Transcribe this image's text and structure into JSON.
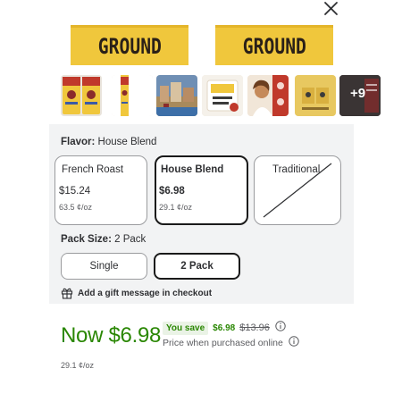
{
  "hero": {
    "bag_text_left": "GROUND",
    "bag_text_right": "GROUND"
  },
  "thumbnails": {
    "items": [
      {
        "name": "product-front-back",
        "bg": "#e9e4dc"
      },
      {
        "name": "product-side",
        "bg": "#f4efe6"
      },
      {
        "name": "cafe-street",
        "bg": "#6f8fb4"
      },
      {
        "name": "sample-card",
        "bg": "#f5f1ea"
      },
      {
        "name": "arabica-lifestyle",
        "bg": "#f1e6d8"
      },
      {
        "name": "bag-details",
        "bg": "#e8c860"
      }
    ],
    "more_count": "+9"
  },
  "flavor": {
    "label": "Flavor:",
    "value": "House Blend",
    "options": [
      {
        "name": "French Roast",
        "price": "$15.24",
        "unit": "63.5 ¢/oz",
        "state": "default"
      },
      {
        "name": "House Blend",
        "price": "$6.98",
        "unit": "29.1 ¢/oz",
        "state": "selected"
      },
      {
        "name": "Traditional",
        "price": "",
        "unit": "",
        "state": "unavailable"
      }
    ]
  },
  "pack_size": {
    "label": "Pack Size:",
    "value": "2 Pack",
    "options": [
      {
        "name": "Single",
        "state": "default"
      },
      {
        "name": "2 Pack",
        "state": "selected"
      }
    ]
  },
  "gift": {
    "label": "Add a gift message in checkout"
  },
  "price": {
    "now": "Now $6.98",
    "you_save_label": "You save",
    "save_amount": "$6.98",
    "original_price": "$13.96",
    "online_note": "Price when purchased online",
    "unit_price": "29.1 ¢/oz"
  },
  "colors": {
    "price_green": "#2a8703",
    "panel_bg": "#f2f3f4",
    "bag_yellow": "#f0c73c",
    "selected_border": "#1a1a1a"
  }
}
